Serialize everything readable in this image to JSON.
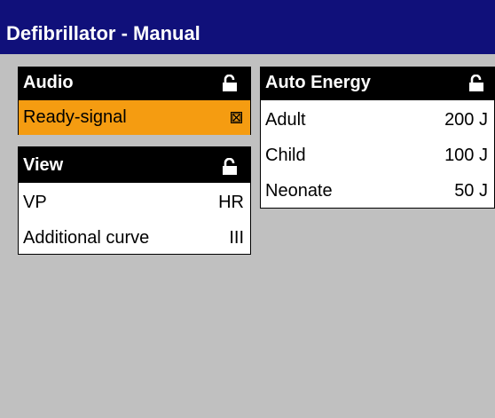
{
  "window": {
    "title": "Defibrillator - Manual"
  },
  "panels": {
    "audio": {
      "title": "Audio",
      "lock_icon": "unlocked-padlock-icon",
      "rows": [
        {
          "label": "Ready-signal",
          "control": "checkbox-checked-icon",
          "selected": true
        }
      ]
    },
    "view": {
      "title": "View",
      "lock_icon": "unlocked-padlock-icon",
      "rows": [
        {
          "label": "VP",
          "value": "HR"
        },
        {
          "label": "Additional curve",
          "value": "III"
        }
      ]
    },
    "auto_energy": {
      "title": "Auto Energy",
      "lock_icon": "unlocked-padlock-icon",
      "rows": [
        {
          "label": "Adult",
          "value": "200 J"
        },
        {
          "label": "Child",
          "value": "100 J"
        },
        {
          "label": "Neonate",
          "value": "50 J"
        }
      ]
    }
  },
  "colors": {
    "titlebar_bg": "#10107a",
    "background": "#c0c0c0",
    "panel_header_bg": "#000000",
    "selection": "#f59c11"
  }
}
